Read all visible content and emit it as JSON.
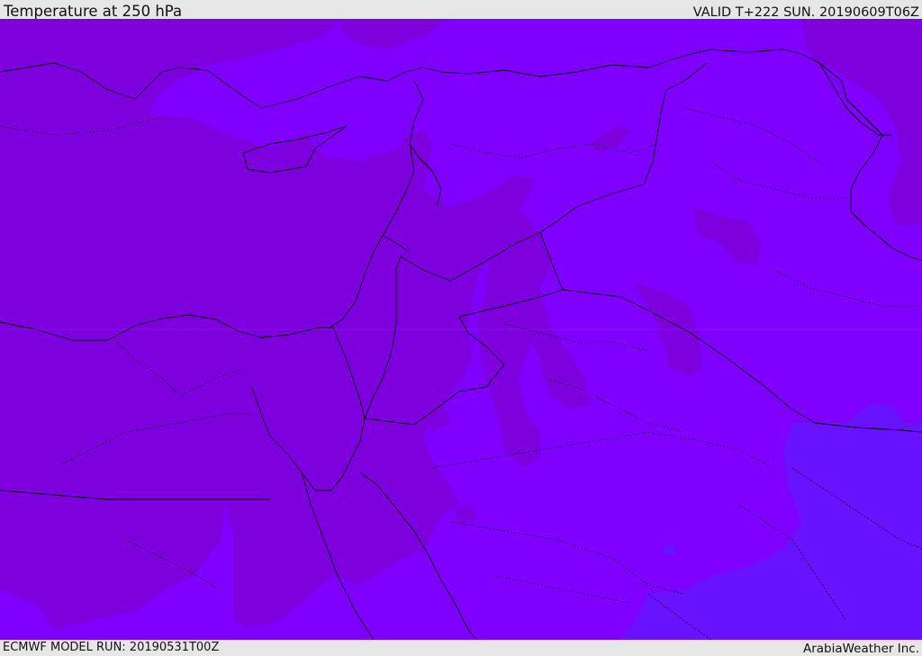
{
  "header": {
    "title": "Temperature at 250 hPa",
    "valid": "VALID T+222 SUN. 20190609T06Z"
  },
  "footer": {
    "model_run": "ECMWF MODEL RUN: 20190531T00Z",
    "credit": "ArabiaWeather Inc."
  },
  "colors": {
    "cold_field": "#7e00de",
    "mid_field": "#7f00ff",
    "warm_field": "#6812ff",
    "borders": "#000000"
  }
}
